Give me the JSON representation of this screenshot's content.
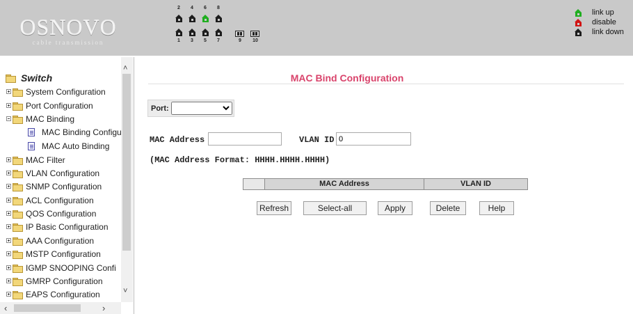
{
  "header": {
    "logo_main": "OSNOVO",
    "logo_sub": "cable transmission",
    "ports": {
      "top_numbers": [
        "2",
        "4",
        "6",
        "8"
      ],
      "bottom_numbers": [
        "1",
        "3",
        "5",
        "7"
      ],
      "fiber_numbers": [
        "9",
        "10"
      ],
      "link_up_ports": [
        "6"
      ]
    },
    "legend": {
      "link_up": "link up",
      "disable": "disable",
      "link_down": "link down"
    },
    "colors": {
      "link_up": "#1fae1f",
      "disable": "#d11414",
      "link_down": "#1d1d1d"
    }
  },
  "sidebar": {
    "root": "Switch",
    "items": [
      {
        "label": "System Configuration",
        "type": "folder",
        "expanded": false
      },
      {
        "label": "Port Configuration",
        "type": "folder",
        "expanded": false
      },
      {
        "label": "MAC Binding",
        "type": "folder",
        "expanded": true
      },
      {
        "label": "MAC Binding Configur",
        "type": "page",
        "indent": 1
      },
      {
        "label": "MAC Auto Binding",
        "type": "page",
        "indent": 1
      },
      {
        "label": "MAC Filter",
        "type": "folder",
        "expanded": false
      },
      {
        "label": "VLAN Configuration",
        "type": "folder",
        "expanded": false
      },
      {
        "label": "SNMP Configuration",
        "type": "folder",
        "expanded": false
      },
      {
        "label": "ACL Configuration",
        "type": "folder",
        "expanded": false
      },
      {
        "label": "QOS Configuration",
        "type": "folder",
        "expanded": false
      },
      {
        "label": "IP Basic Configuration",
        "type": "folder",
        "expanded": false
      },
      {
        "label": "AAA Configuration",
        "type": "folder",
        "expanded": false
      },
      {
        "label": "MSTP Configuration",
        "type": "folder",
        "expanded": false
      },
      {
        "label": "IGMP SNOOPING Confi",
        "type": "folder",
        "expanded": false
      },
      {
        "label": "GMRP Configuration",
        "type": "folder",
        "expanded": false
      },
      {
        "label": "EAPS Configuration",
        "type": "folder",
        "expanded": false
      }
    ]
  },
  "main": {
    "title": "MAC Bind Configuration",
    "title_color": "#d9436b",
    "port_label": "Port:",
    "port_value": "",
    "mac_label": "MAC Address",
    "mac_value": "",
    "vlan_label": "VLAN ID",
    "vlan_value": "0",
    "format_note": "(MAC Address Format: HHHH.HHHH.HHHH)",
    "table_headers": [
      "",
      "MAC Address",
      "VLAN ID"
    ],
    "buttons": {
      "refresh": "Refresh",
      "select_all": "Select-all",
      "apply": "Apply",
      "delete": "Delete",
      "help": "Help"
    }
  }
}
